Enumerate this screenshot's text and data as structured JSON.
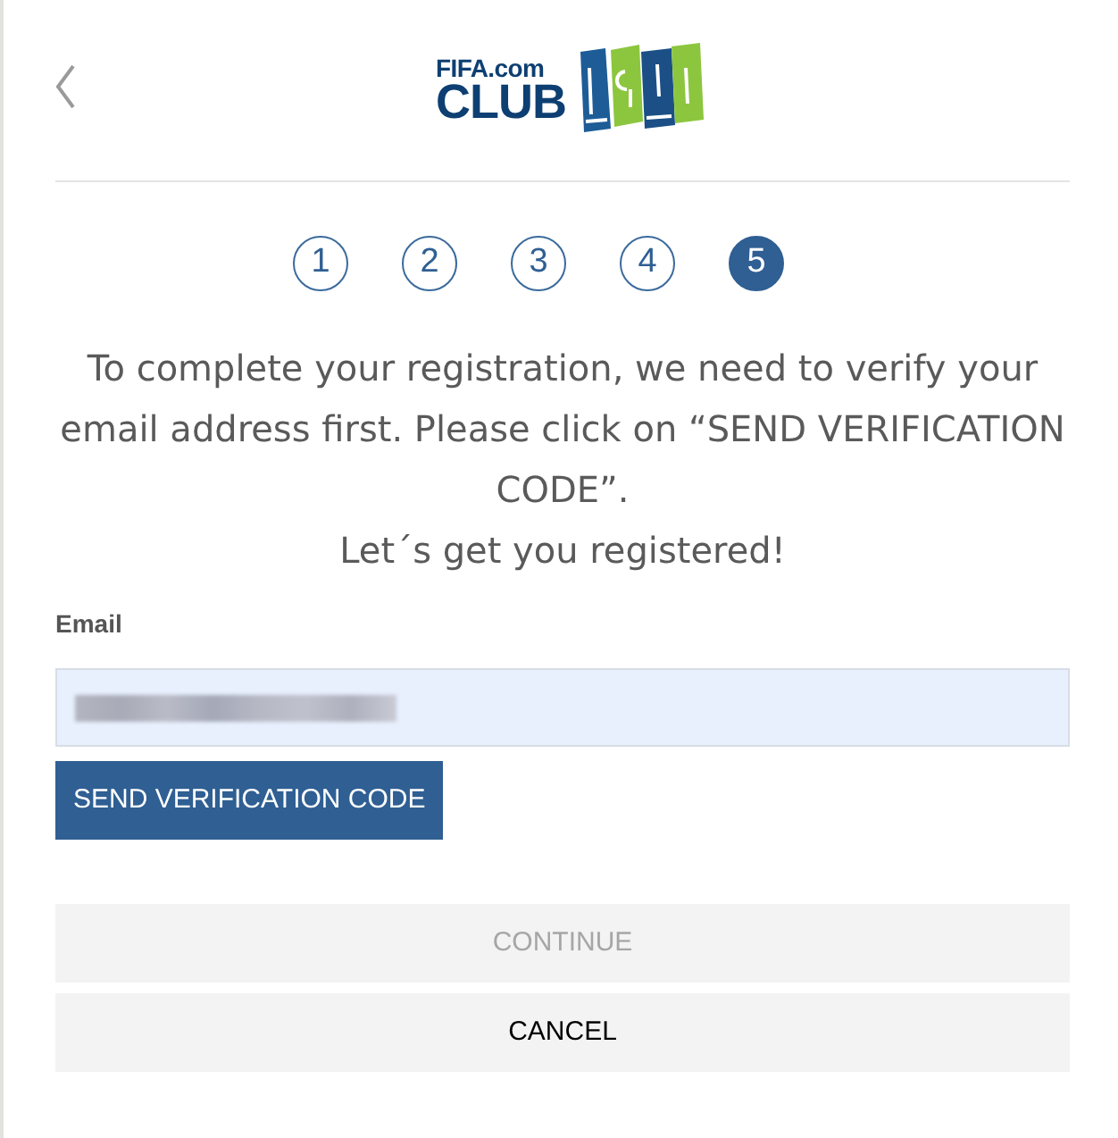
{
  "header": {
    "back_button": {
      "kind": "chevron"
    },
    "logo": {
      "line_1": "FIFA.com",
      "line_2": "CLUB"
    }
  },
  "steps": [
    {
      "label": "1",
      "current": false
    },
    {
      "label": "2",
      "current": false
    },
    {
      "label": "3",
      "current": false
    },
    {
      "label": "4",
      "current": false
    },
    {
      "label": "5",
      "current": true
    }
  ],
  "intro": [
    "To complete your registration, we need to verify your email address first. Please click on “SEND VERIFICATION CODE”.",
    "Let´s get you registered!"
  ],
  "email": {
    "label": "Email",
    "redacted": true
  },
  "send_button": {
    "label": "SEND VERIFICATION CODE"
  },
  "buttons": [
    {
      "label": "CONTINUE",
      "disabled": true
    },
    {
      "label": "CANCEL",
      "disabled": false
    }
  ]
}
